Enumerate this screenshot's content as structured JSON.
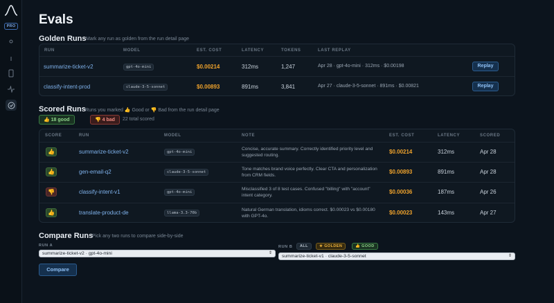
{
  "app": {
    "badge": "PRO"
  },
  "page": {
    "title": "Evals"
  },
  "golden": {
    "title": "Golden Runs",
    "subtitle": "Mark any run as golden from the run detail page",
    "headers": [
      "RUN",
      "MODEL",
      "EST. COST",
      "LATENCY",
      "TOKENS",
      "LAST REPLAY"
    ],
    "rows": [
      {
        "run": "summarize-ticket-v2",
        "model": "gpt-4o-mini",
        "cost": "$0.00214",
        "latency": "312ms",
        "tokens": "1,247",
        "replay": "Apr 28 · gpt-4o-mini · 312ms · $0.00198",
        "action": "Replay"
      },
      {
        "run": "classify-intent-prod",
        "model": "claude-3-5-sonnet",
        "cost": "$0.00893",
        "latency": "891ms",
        "tokens": "3,841",
        "replay": "Apr 27 · claude-3-5-sonnet · 891ms · $0.00821",
        "action": "Replay"
      }
    ]
  },
  "scored": {
    "title": "Scored Runs",
    "subtitle": "Runs you marked 👍 Good or 👎 Bad from the run detail page",
    "good_pill": "👍 18 good",
    "bad_pill": "👎 4 bad",
    "total": "22 total scored",
    "headers": [
      "SCORE",
      "RUN",
      "MODEL",
      "NOTE",
      "EST. COST",
      "LATENCY",
      "SCORED"
    ],
    "rows": [
      {
        "score": "good",
        "icon": "👍",
        "run": "summarize-ticket-v2",
        "model": "gpt-4o-mini",
        "note": "Concise, accurate summary. Correctly identified priority level and suggested routing.",
        "cost": "$0.00214",
        "latency": "312ms",
        "scored": "Apr 28"
      },
      {
        "score": "good",
        "icon": "👍",
        "run": "gen-email-q2",
        "model": "claude-3-5-sonnet",
        "note": "Tone matches brand voice perfectly. Clear CTA and personalization from CRM fields.",
        "cost": "$0.00893",
        "latency": "891ms",
        "scored": "Apr 28"
      },
      {
        "score": "bad",
        "icon": "👎",
        "run": "classify-intent-v1",
        "model": "gpt-4o-mini",
        "note": "Misclassified 3 of 8 test cases. Confused \"billing\" with \"account\" intent category.",
        "cost": "$0.00036",
        "latency": "187ms",
        "scored": "Apr 26"
      },
      {
        "score": "good",
        "icon": "👍",
        "run": "translate-product-de",
        "model": "llama-3.3-70b",
        "note": "Natural German translation, idioms correct. $0.00023 vs $0.00180 with GPT-4o.",
        "cost": "$0.00023",
        "latency": "143ms",
        "scored": "Apr 27"
      }
    ]
  },
  "compare": {
    "title": "Compare Runs",
    "subtitle": "Pick any two runs to compare side-by-side",
    "run_a_label": "RUN A",
    "run_a_value": "summarize-ticket-v2 · gpt-4o-mini",
    "run_b_label": "RUN B",
    "filter_all": "ALL",
    "filter_golden": "★ GOLDEN",
    "filter_good": "👍 GOOD",
    "run_b_value": "summarize-ticket-v1 · claude-3-5-sonnet",
    "button": "Compare"
  }
}
